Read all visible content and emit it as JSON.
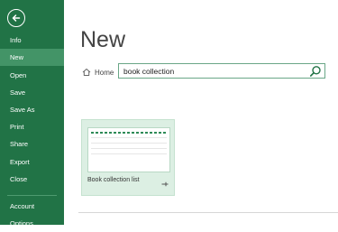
{
  "sidebar": {
    "items": [
      {
        "label": "Info",
        "active": false
      },
      {
        "label": "New",
        "active": true
      },
      {
        "label": "Open",
        "active": false
      },
      {
        "label": "Save",
        "active": false
      },
      {
        "label": "Save As",
        "active": false
      },
      {
        "label": "Print",
        "active": false
      },
      {
        "label": "Share",
        "active": false
      },
      {
        "label": "Export",
        "active": false
      },
      {
        "label": "Close",
        "active": false
      },
      {
        "label": "Account",
        "active": false
      },
      {
        "label": "Options",
        "active": false
      }
    ],
    "back_icon": "back-arrow-icon"
  },
  "main": {
    "title": "New",
    "home_label": "Home",
    "search": {
      "value": "book collection"
    }
  },
  "templates": [
    {
      "label": "Book collection list"
    }
  ],
  "colors": {
    "sidebar_bg": "#217346",
    "sidebar_active": "#439467",
    "card_bg": "#dcefe3"
  }
}
